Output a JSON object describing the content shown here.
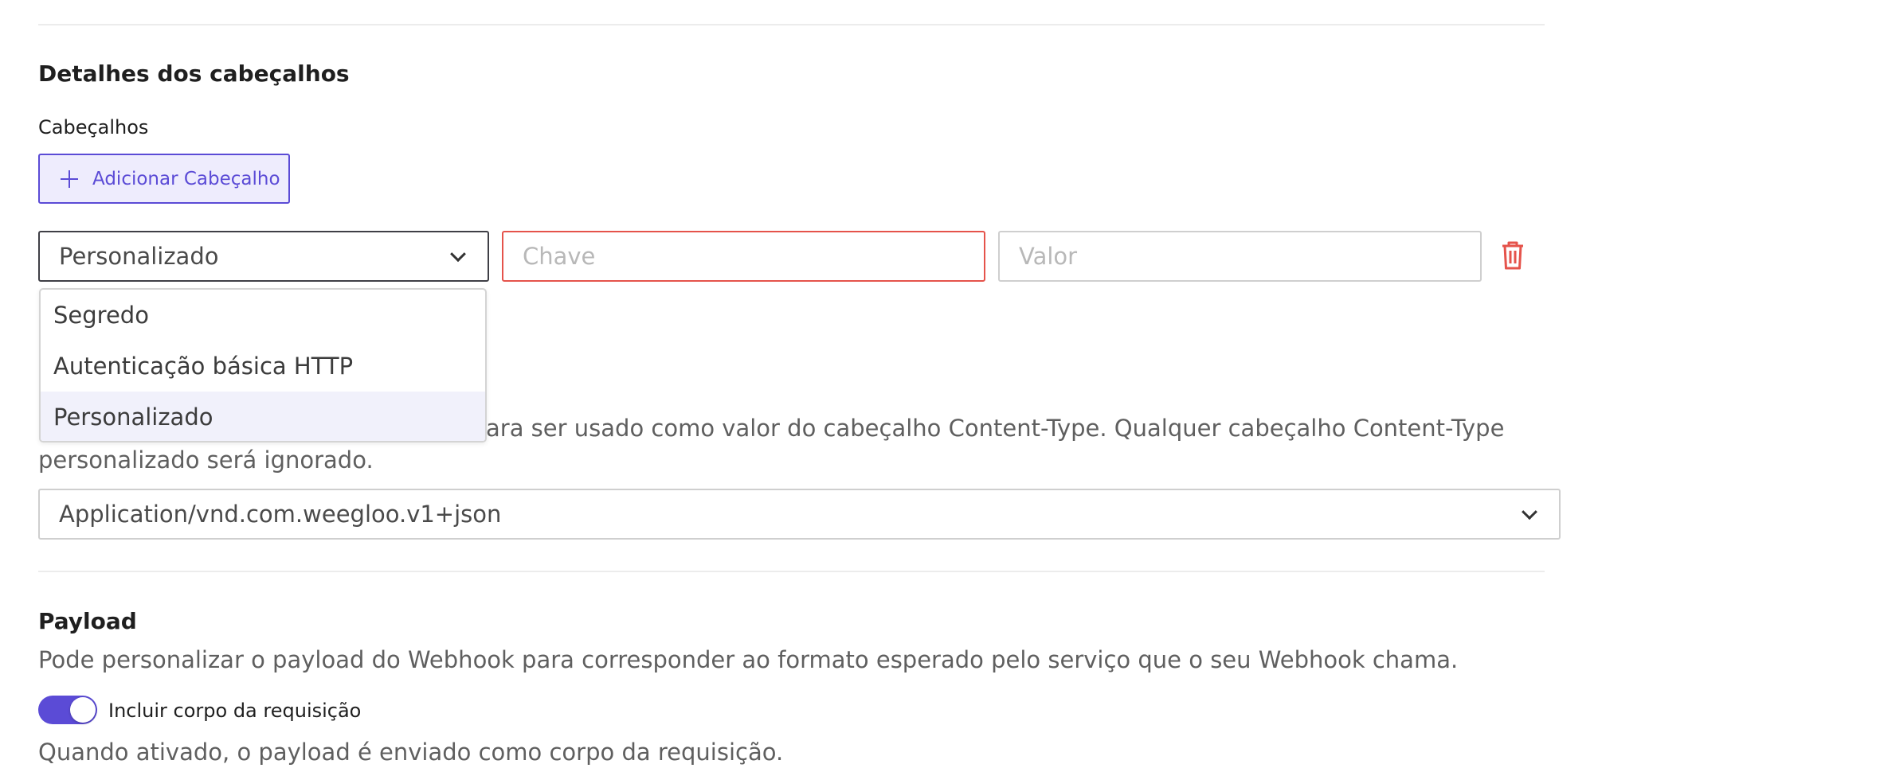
{
  "headers_section": {
    "title": "Detalhes dos cabeçalhos",
    "label": "Cabeçalhos",
    "add_button": "Adicionar Cabeçalho",
    "row": {
      "type_value": "Personalizado",
      "key_placeholder": "Chave",
      "value_placeholder": "Valor"
    },
    "dropdown_options": [
      {
        "label": "Segredo"
      },
      {
        "label": "Autenticação básica HTTP"
      },
      {
        "label": "Personalizado"
      }
    ],
    "content_type_help_line1": "ara ser usado como valor do cabeçalho Content-Type. Qualquer cabeçalho Content-Type",
    "content_type_help_line2": "personalizado será ignorado.",
    "content_type_value": "Application/vnd.com.weegloo.v1+json"
  },
  "payload_section": {
    "title": "Payload",
    "description": "Pode personalizar o payload do Webhook para corresponder ao formato esperado pelo serviço que o seu Webhook chama.",
    "toggle_label": "Incluir corpo da requisição",
    "toggle_on": true,
    "toggle_help": "Quando ativado, o payload é enviado como corpo da requisição."
  },
  "colors": {
    "accent": "#5b4bd6",
    "error": "#e5534b"
  }
}
